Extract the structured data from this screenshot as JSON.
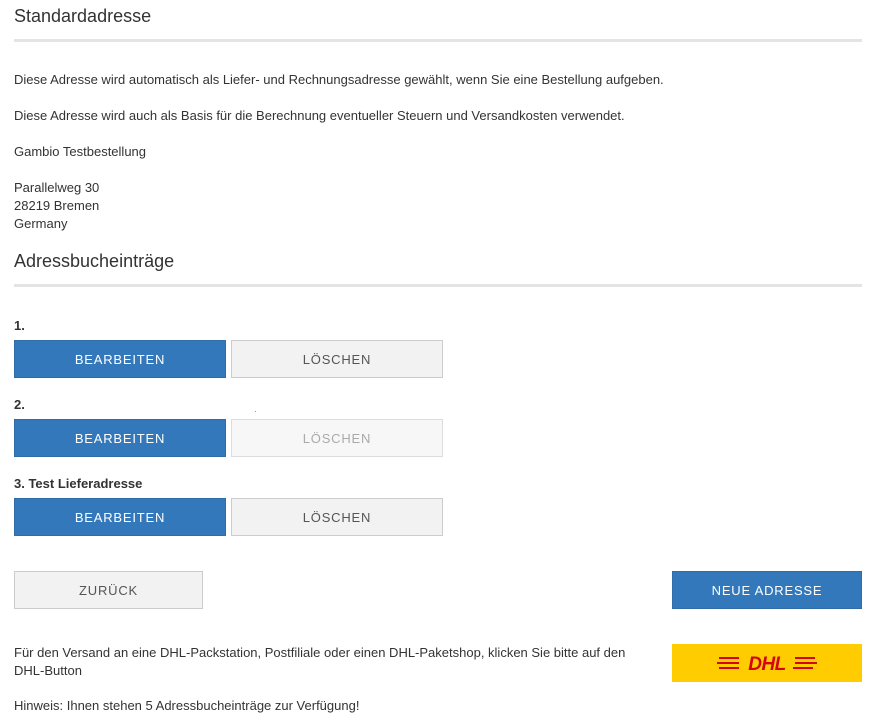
{
  "default_address": {
    "heading": "Standardadresse",
    "info1": "Diese Adresse wird automatisch als Liefer- und Rechnungsadresse gewählt, wenn Sie eine Bestellung aufgeben.",
    "info2": "Diese Adresse wird auch als Basis für die Berechnung eventueller Steuern und Versandkosten verwendet.",
    "name": "Gambio Testbestellung",
    "street": "Parallelweg 30",
    "city": "28219 Bremen",
    "country": "Germany"
  },
  "address_book": {
    "heading": "Adressbucheinträge",
    "entries": [
      {
        "label": "1.",
        "edit": "BEARBEITEN",
        "delete": "LÖSCHEN",
        "delete_enabled": true
      },
      {
        "label": "2.",
        "edit": "BEARBEITEN",
        "delete": "LÖSCHEN",
        "delete_enabled": false
      },
      {
        "label": "3. Test Lieferadresse",
        "edit": "BEARBEITEN",
        "delete": "LÖSCHEN",
        "delete_enabled": true
      }
    ]
  },
  "actions": {
    "back": "ZURÜCK",
    "new_address": "NEUE ADRESSE"
  },
  "footer": {
    "dhl_text": "Für den Versand an eine DHL-Packstation, Postfiliale oder einen DHL-Paketshop, klicken Sie bitte auf den DHL-Button",
    "dhl_logo_text": "DHL",
    "hint": "Hinweis: Ihnen stehen 5 Adressbucheinträge zur Verfügung!"
  },
  "colors": {
    "primary": "#3378ba",
    "dhl_yellow": "#ffcc00",
    "dhl_red": "#d40511"
  }
}
